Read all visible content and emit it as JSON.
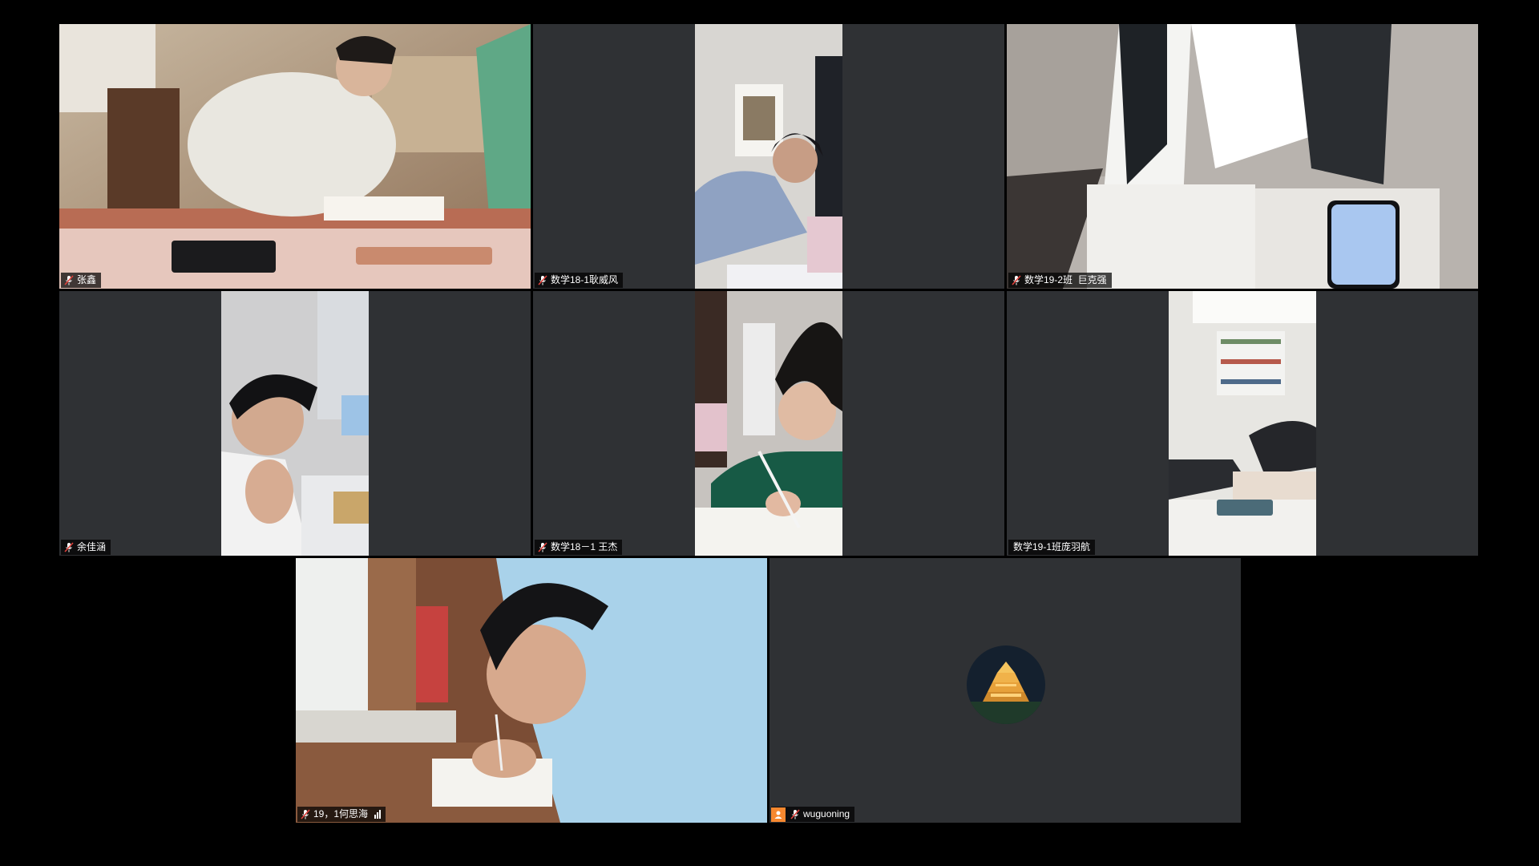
{
  "meeting": {
    "layout": "gallery",
    "participants": [
      {
        "name": "张鑫",
        "video": "on",
        "muted": true
      },
      {
        "name": "数学18-1耿威风",
        "video": "on",
        "muted": true
      },
      {
        "name": "数学19-2班  巨克强",
        "video": "on",
        "muted": true
      },
      {
        "name": "余佳涵",
        "video": "on",
        "muted": true
      },
      {
        "name": "数学18－1 王杰",
        "video": "on",
        "muted": true
      },
      {
        "name": "数学19-1班庞羽航",
        "video": "on",
        "muted": false
      },
      {
        "name": "19，1何思海",
        "video": "on",
        "muted": true,
        "signal_bars": 3
      },
      {
        "name": "wuguoning",
        "video": "off",
        "muted": true,
        "avatar": "pavilion-night-photo"
      }
    ]
  },
  "colors": {
    "background": "#000000",
    "tile_empty": "#2f3134",
    "nameplate_bg": "rgba(0,0,0,0.72)",
    "mute_icon": "#e0413b",
    "host_chip": "#f7882f"
  },
  "icons": {
    "mute": "muted-microphone-icon",
    "signal": "signal-strength-icon",
    "host": "user-avatar-icon"
  }
}
